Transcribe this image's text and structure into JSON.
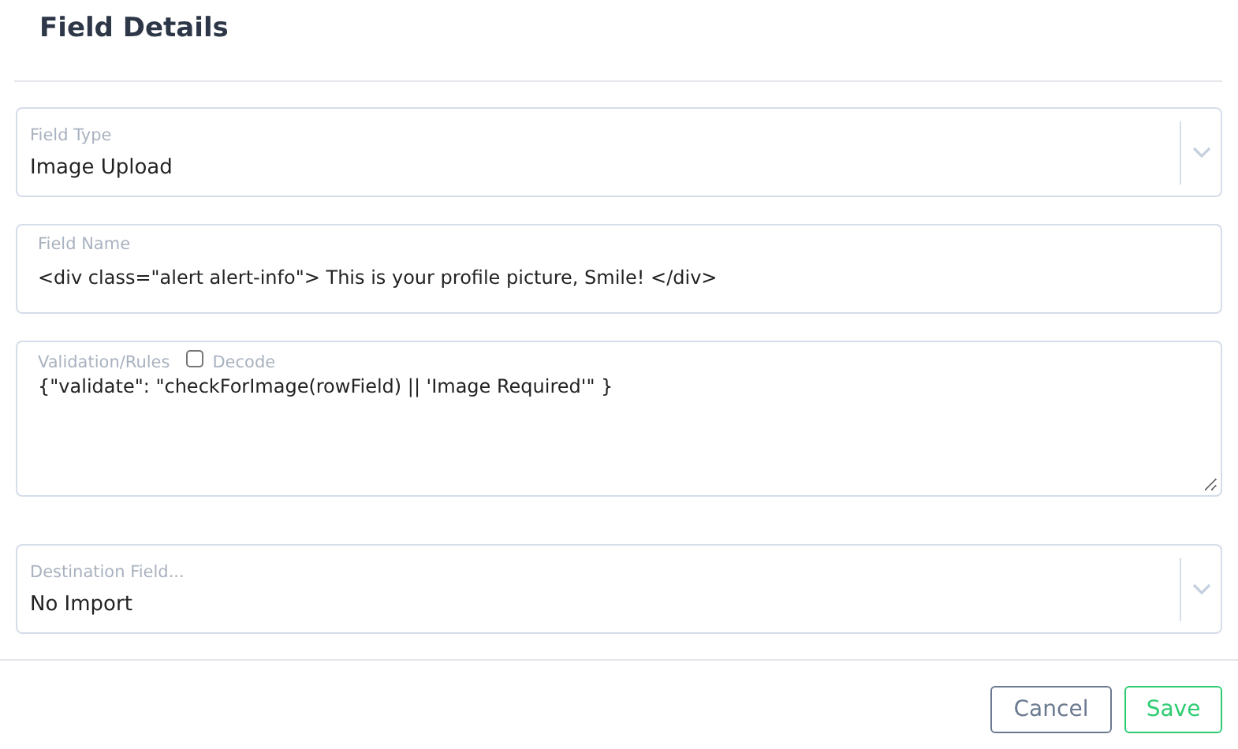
{
  "title": "Field Details",
  "fields": [
    {
      "kind": "select",
      "label": "Field Type",
      "value": "Image Upload"
    },
    {
      "kind": "text",
      "label": "Field Name",
      "value": "<div class=\"alert alert-info\"> This is your profile picture, Smile! </div>"
    },
    {
      "kind": "textarea",
      "label": "Validation/Rules",
      "value": "{\"validate\": \"checkForImage(rowField) || 'Image Required'\" }",
      "option": {
        "label": "Decode",
        "checked": false
      }
    },
    {
      "kind": "select",
      "label": "Destination Field...",
      "value": "No Import"
    }
  ],
  "buttons": [
    {
      "kind": "secondary",
      "label": "Cancel"
    },
    {
      "kind": "primary",
      "label": "Save"
    }
  ]
}
